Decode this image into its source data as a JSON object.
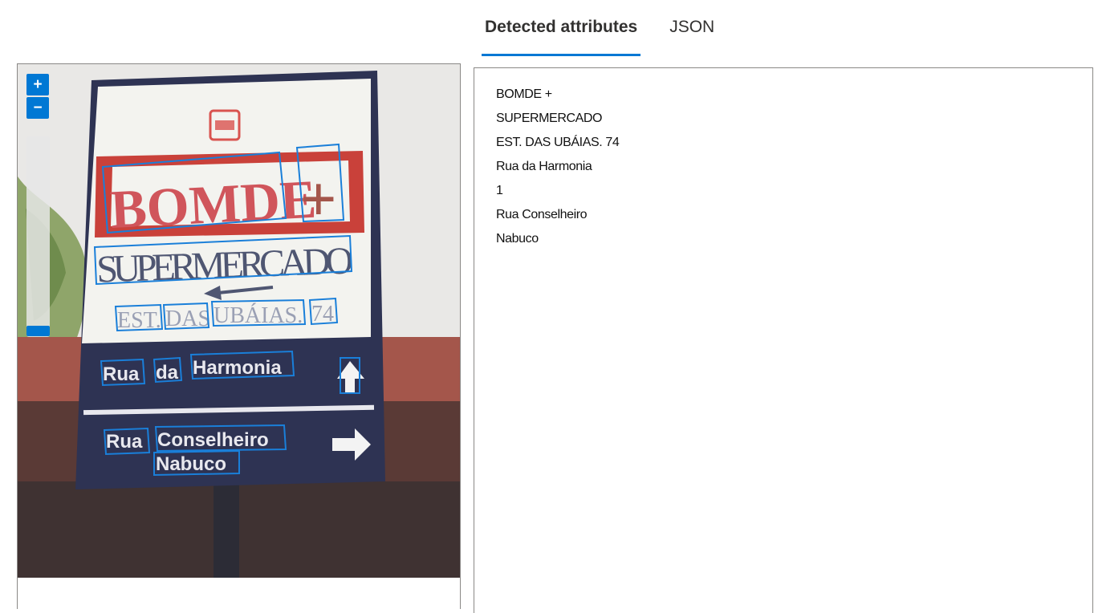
{
  "tabs": [
    {
      "label": "Detected attributes",
      "active": true
    },
    {
      "label": "JSON",
      "active": false
    }
  ],
  "viewer": {
    "zoom_in_label": "+",
    "zoom_out_label": "−",
    "sign": {
      "logo_text": "BOMDE",
      "logo_plus": "+",
      "supermercado": "SUPERMERCADO",
      "address_words": [
        "EST.",
        "DAS",
        "UBÁIAS.",
        "74"
      ],
      "street1": [
        "Rua",
        "da",
        "Harmonia"
      ],
      "street2": [
        "Rua",
        "Conselheiro"
      ],
      "street2_line2": "Nabuco"
    }
  },
  "results": {
    "lines": [
      "BOMDE +",
      "SUPERMERCADO",
      "EST. DAS UBÁIAS. 74",
      "Rua da Harmonia",
      "1",
      "Rua Conselheiro",
      "Nabuco"
    ]
  },
  "colors": {
    "accent": "#0078d4",
    "sign_navy": "#2e3353",
    "sign_red": "#d9534f",
    "border": "#8a8886"
  }
}
